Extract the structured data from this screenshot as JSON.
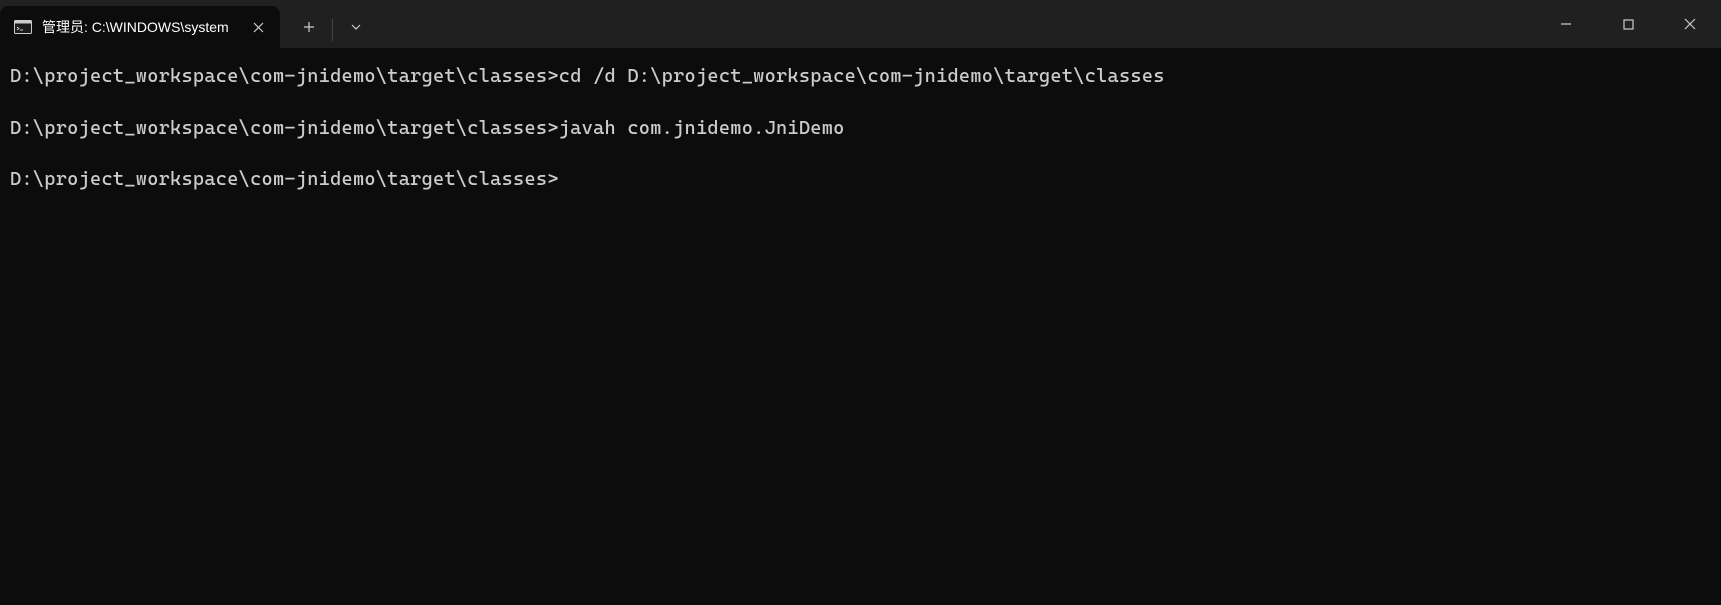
{
  "titlebar": {
    "tab": {
      "title": "管理员: C:\\WINDOWS\\system"
    }
  },
  "terminal": {
    "lines": [
      {
        "prompt": "D:\\project_workspace\\com-jnidemo\\target\\classes>",
        "command": "cd /d D:\\project_workspace\\com-jnidemo\\target\\classes"
      },
      {
        "prompt": "D:\\project_workspace\\com-jnidemo\\target\\classes>",
        "command": "javah com.jnidemo.JniDemo"
      },
      {
        "prompt": "D:\\project_workspace\\com-jnidemo\\target\\classes>",
        "command": ""
      }
    ]
  }
}
